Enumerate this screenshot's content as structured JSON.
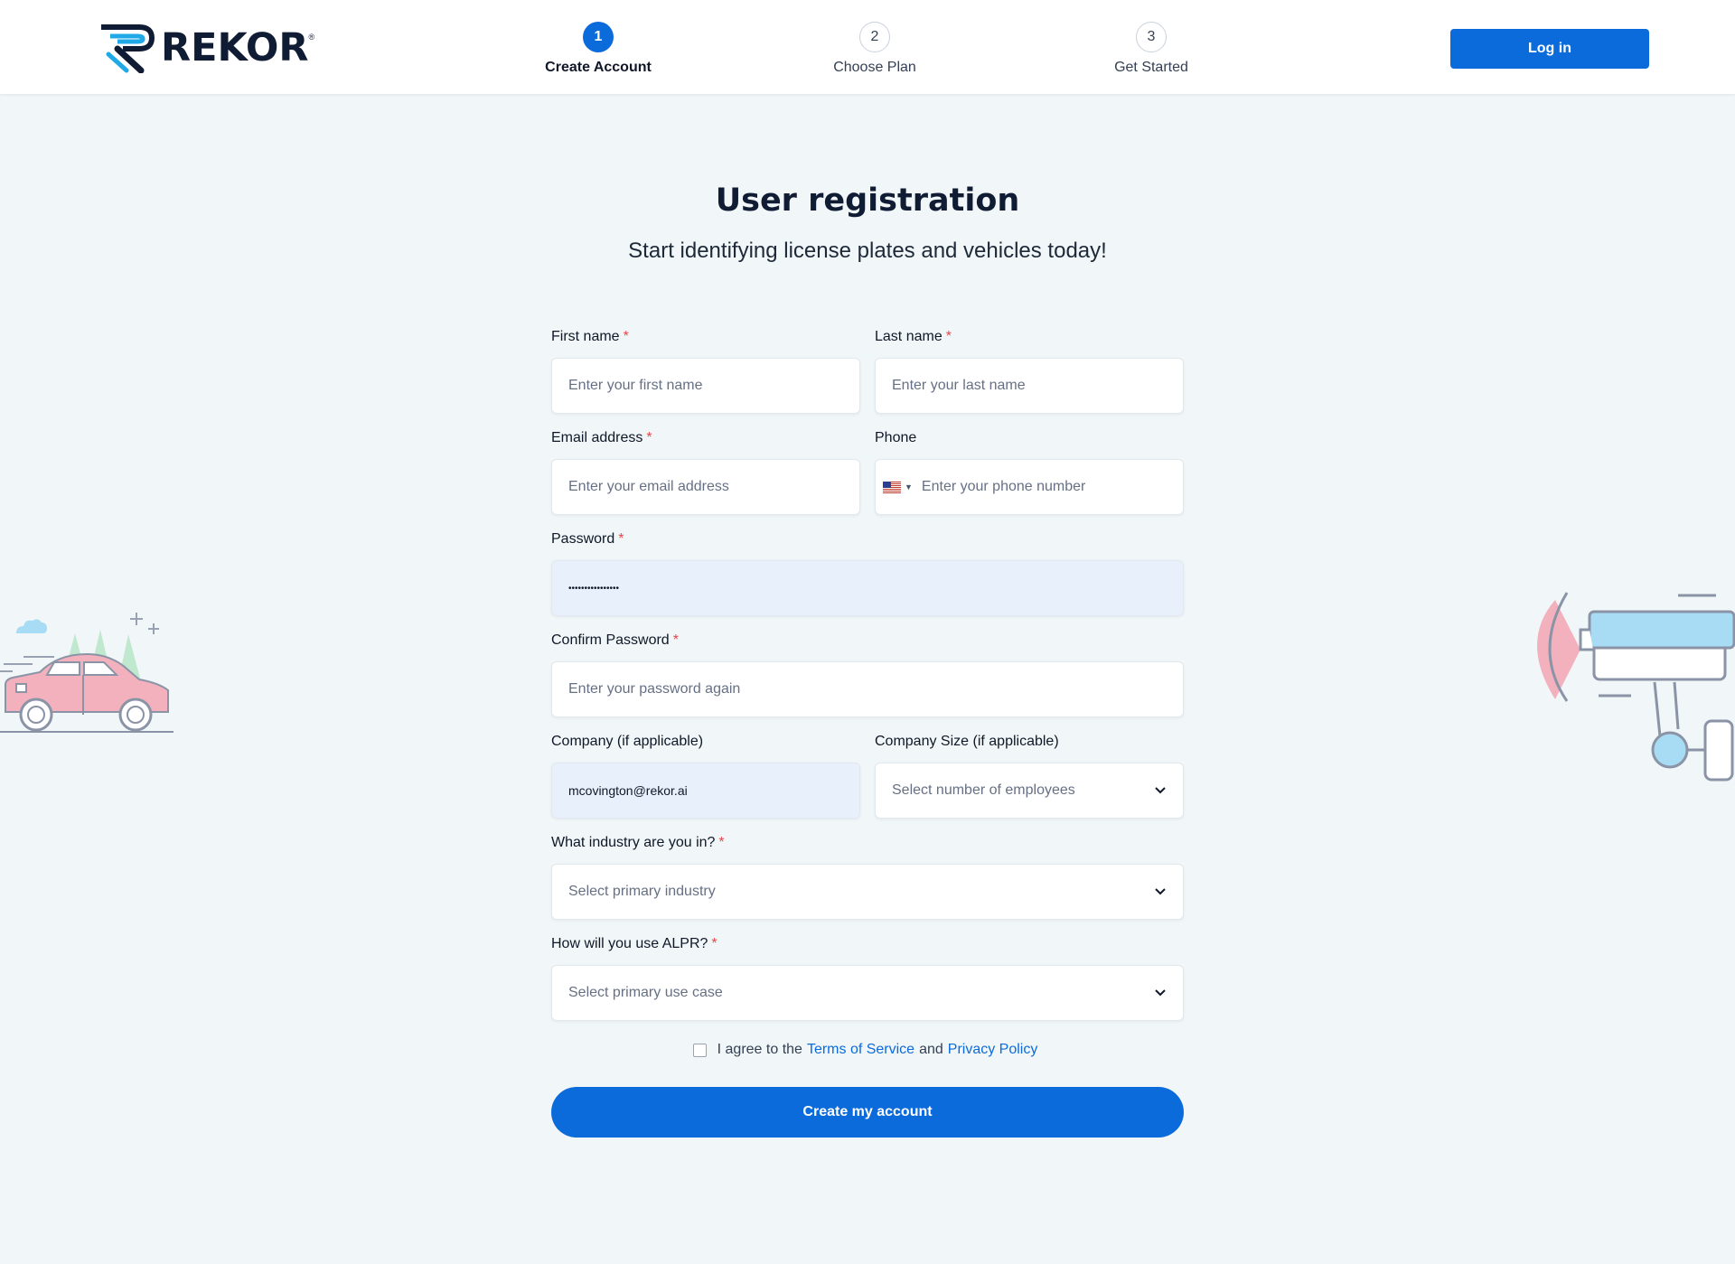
{
  "brand": {
    "name": "REKOR",
    "mark": "®"
  },
  "steps": [
    {
      "number": "1",
      "label": "Create Account",
      "active": true
    },
    {
      "number": "2",
      "label": "Choose Plan",
      "active": false
    },
    {
      "number": "3",
      "label": "Get Started",
      "active": false
    }
  ],
  "header": {
    "login_label": "Log in"
  },
  "page": {
    "title": "User registration",
    "subtitle": "Start identifying license plates and vehicles today!"
  },
  "form": {
    "required_mark": "*",
    "first_name": {
      "label": "First name",
      "placeholder": "Enter your first name"
    },
    "last_name": {
      "label": "Last name",
      "placeholder": "Enter your last name"
    },
    "email": {
      "label": "Email address",
      "placeholder": "Enter your email address"
    },
    "phone": {
      "label": "Phone",
      "placeholder": "Enter your phone number",
      "country": "US"
    },
    "password": {
      "label": "Password",
      "value": "••••••••••••••••"
    },
    "confirm_password": {
      "label": "Confirm Password",
      "placeholder": "Enter your password again"
    },
    "company": {
      "label": "Company (if applicable)",
      "value": "mcovington@rekor.ai"
    },
    "company_size": {
      "label": "Company Size (if applicable)",
      "placeholder": "Select number of employees"
    },
    "industry": {
      "label": "What industry are you in?",
      "placeholder": "Select primary industry"
    },
    "alpr_use": {
      "label": "How will you use ALPR?",
      "placeholder": "Select primary use case"
    },
    "agree": {
      "prefix": "I agree to the",
      "terms": "Terms of Service",
      "and": "and",
      "privacy": "Privacy Policy"
    },
    "submit_label": "Create my account"
  },
  "colors": {
    "primary": "#0b6bdb",
    "background": "#f1f6f8",
    "required": "#e5484d",
    "autofill": "#e8f0fc"
  },
  "icons": [
    "chevron-down-icon",
    "us-flag-icon",
    "car-illustration",
    "camera-illustration"
  ]
}
